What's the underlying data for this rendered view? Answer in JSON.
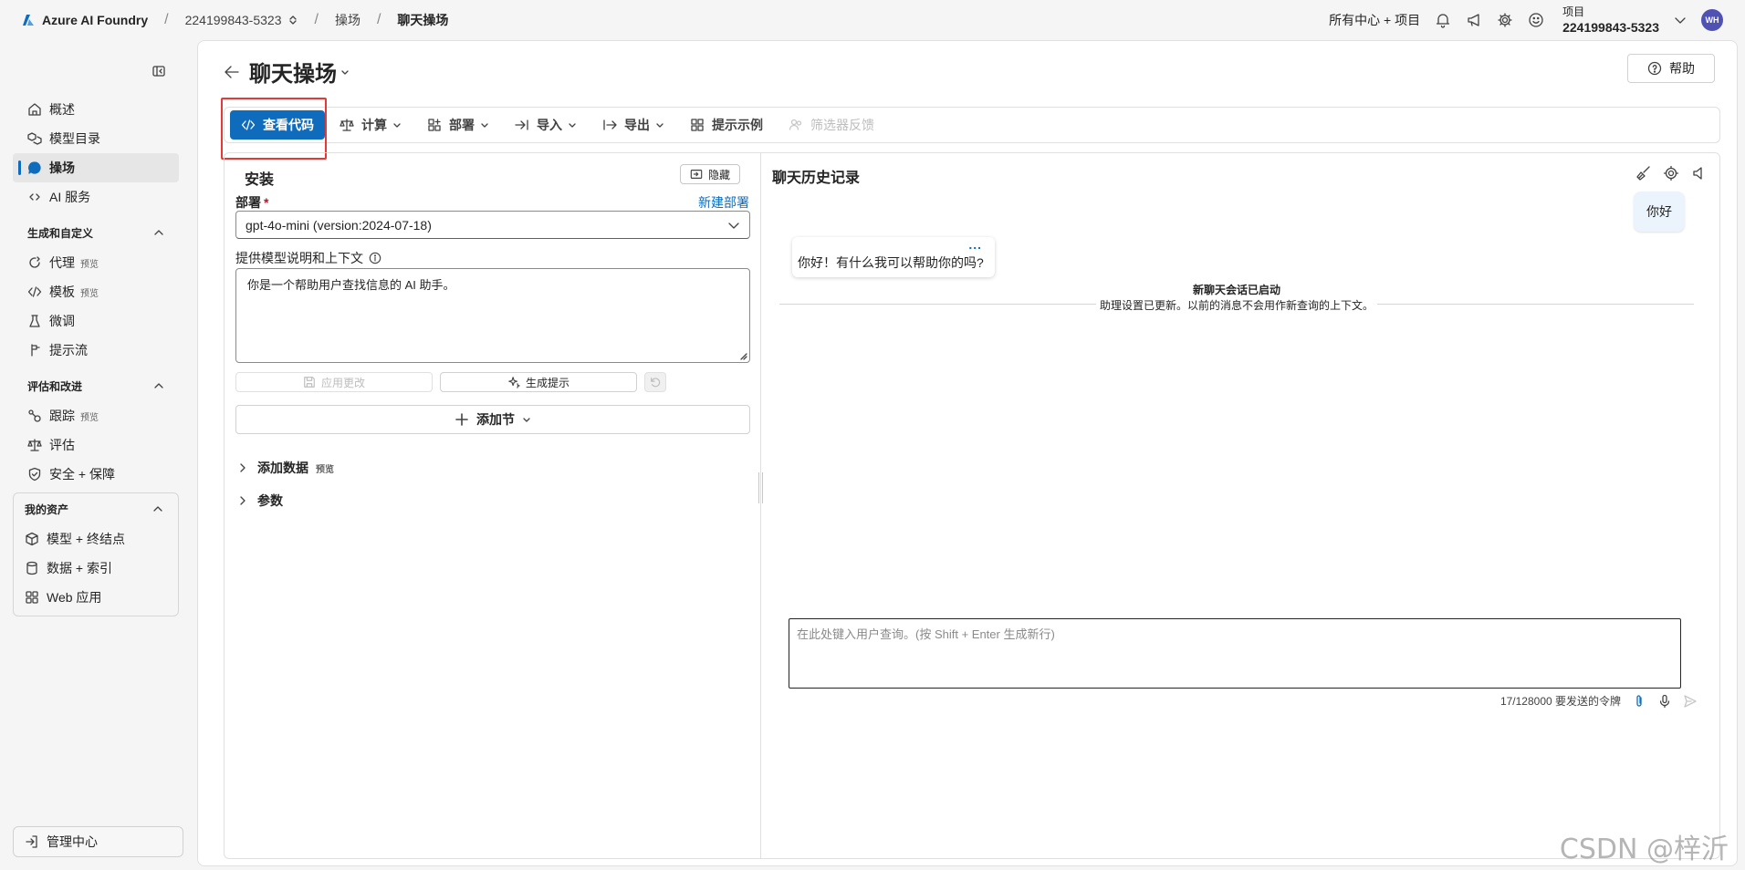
{
  "topbar": {
    "brand": "Azure AI Foundry",
    "breadcrumb": [
      "224199843-5323",
      "操场",
      "聊天操场"
    ],
    "hub_label": "所有中心 + 项目",
    "project_label": "项目",
    "project_value": "224199843-5323",
    "avatar": "WH"
  },
  "sidebar": {
    "items_top": [
      {
        "label": "概述",
        "icon": "home-icon"
      },
      {
        "label": "模型目录",
        "icon": "cube-stack-icon"
      },
      {
        "label": "操场",
        "icon": "chat-icon"
      },
      {
        "label": "AI 服务",
        "icon": "link-icon"
      }
    ],
    "group_build": {
      "label": "生成和自定义",
      "items": [
        {
          "label": "代理",
          "badge": "预览",
          "icon": "agent-icon"
        },
        {
          "label": "模板",
          "badge": "预览",
          "icon": "code-icon"
        },
        {
          "label": "微调",
          "icon": "beaker-icon"
        },
        {
          "label": "提示流",
          "icon": "flow-icon"
        }
      ]
    },
    "group_eval": {
      "label": "评估和改进",
      "items": [
        {
          "label": "跟踪",
          "badge": "预览",
          "icon": "trace-icon"
        },
        {
          "label": "评估",
          "icon": "scale-icon"
        },
        {
          "label": "安全 + 保障",
          "icon": "shield-icon"
        }
      ]
    },
    "group_assets": {
      "label": "我的资产",
      "items": [
        {
          "label": "模型 + 终结点",
          "icon": "cube-icon"
        },
        {
          "label": "数据 + 索引",
          "icon": "database-icon"
        },
        {
          "label": "Web 应用",
          "icon": "apps-icon"
        }
      ]
    },
    "management": "管理中心"
  },
  "page": {
    "title": "聊天操场",
    "help": "帮助"
  },
  "toolbar": {
    "view_code": "查看代码",
    "compute": "计算",
    "deploy": "部署",
    "import": "导入",
    "export": "导出",
    "samples": "提示示例",
    "feedback": "筛选器反馈"
  },
  "setup": {
    "title": "安装",
    "hide": "隐藏",
    "deployment_label": "部署",
    "required": "*",
    "new_deployment": "新建部署",
    "deployment_value": "gpt-4o-mini (version:2024-07-18)",
    "instructions_label": "提供模型说明和上下文",
    "instructions_value": "你是一个帮助用户查找信息的 AI 助手。",
    "apply_changes": "应用更改",
    "generate_prompt": "生成提示",
    "add_section": "添加节",
    "add_data": "添加数据",
    "add_data_badge": "预览",
    "parameters": "参数"
  },
  "chat": {
    "title": "聊天历史记录",
    "user_message": "你好",
    "assistant_message": "你好！有什么我可以帮助你的吗?",
    "assistant_more": "...",
    "session_title": "新聊天会话已启动",
    "session_sub": "助理设置已更新。以前的消息不会用作新查询的上下文。",
    "input_placeholder": "在此处键入用户查询。(按 Shift + Enter 生成新行)",
    "token_count": "17/128000 要发送的令牌"
  },
  "watermark": "CSDN @梓沂",
  "colors": {
    "accent": "#0f6cbd",
    "highlight": "#e53935"
  }
}
